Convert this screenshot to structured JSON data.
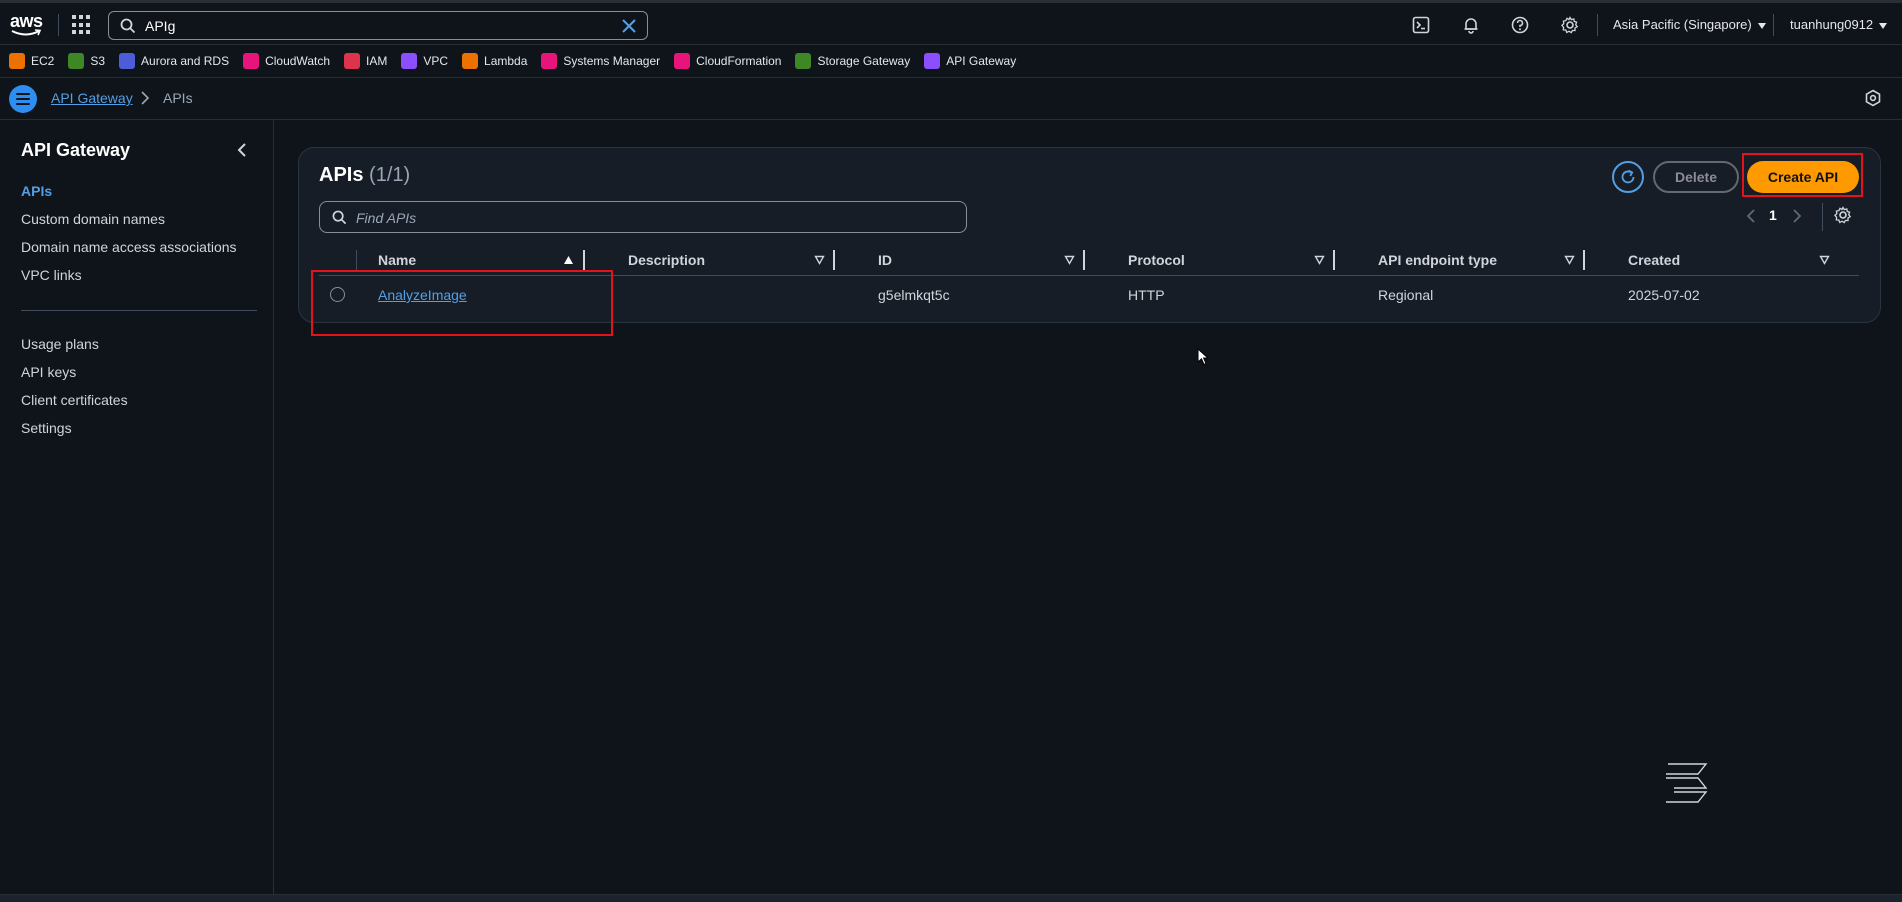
{
  "topnav": {
    "logo_text": "aws",
    "search": {
      "value": "APIg",
      "placeholder": "Search"
    },
    "region": "Asia Pacific (Singapore)",
    "account": "tuanhung0912",
    "icons": [
      "cloudshell-icon",
      "bell-icon",
      "help-icon",
      "gear-icon"
    ]
  },
  "favorites": [
    {
      "label": "EC2",
      "color": "#ed7100"
    },
    {
      "label": "S3",
      "color": "#3f8624"
    },
    {
      "label": "Aurora and RDS",
      "color": "#4d5dd8"
    },
    {
      "label": "CloudWatch",
      "color": "#e7157b"
    },
    {
      "label": "IAM",
      "color": "#dd344c"
    },
    {
      "label": "VPC",
      "color": "#8c4fff"
    },
    {
      "label": "Lambda",
      "color": "#ed7100"
    },
    {
      "label": "Systems Manager",
      "color": "#e7157b"
    },
    {
      "label": "CloudFormation",
      "color": "#e7157b"
    },
    {
      "label": "Storage Gateway",
      "color": "#3f8624"
    },
    {
      "label": "API Gateway",
      "color": "#8c4fff"
    }
  ],
  "breadcrumb": {
    "link": "API Gateway",
    "current": "APIs"
  },
  "sidebar": {
    "title": "API Gateway",
    "items": [
      {
        "label": "APIs",
        "active": true
      },
      {
        "label": "Custom domain names"
      },
      {
        "label": "Domain name access associations"
      },
      {
        "label": "VPC links"
      },
      {
        "label": "Usage plans"
      },
      {
        "label": "API keys"
      },
      {
        "label": "Client certificates"
      },
      {
        "label": "Settings"
      }
    ]
  },
  "panel": {
    "title": "APIs",
    "count": "(1/1)",
    "delete_label": "Delete",
    "create_label": "Create API",
    "find_placeholder": "Find APIs",
    "page": "1",
    "columns": [
      "Name",
      "Description",
      "ID",
      "Protocol",
      "API endpoint type",
      "Created"
    ],
    "rows": [
      {
        "name": "AnalyzeImage",
        "description": "",
        "id": "g5elmkqt5c",
        "protocol": "HTTP",
        "endpoint_type": "Regional",
        "created": "2025-07-02"
      }
    ]
  },
  "colors": {
    "accent_link": "#539fe5",
    "primary_button": "#ff9900",
    "highlight": "#e3131b"
  }
}
